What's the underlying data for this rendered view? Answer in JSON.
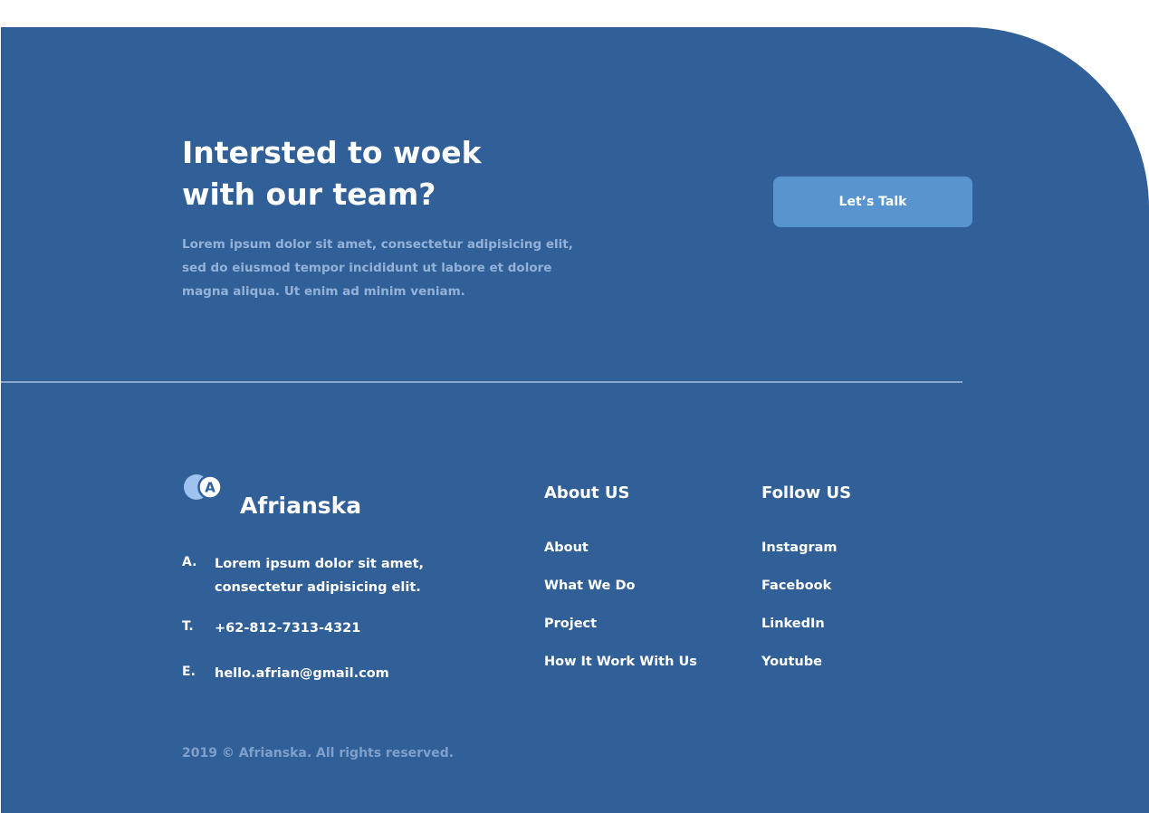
{
  "colors": {
    "page_background": "#ffffff",
    "footer_background": "#316098",
    "button_background": "#5894ce",
    "muted_text": "#94b2d9",
    "divider": "#8aa7cf",
    "logo_light_circle": "#9dc3ee"
  },
  "cta": {
    "heading_lines": [
      "Intersted to woek",
      "with our team?"
    ],
    "body_lines": [
      "Lorem ipsum dolor sit amet, consectetur adipisicing elit,",
      "sed do eiusmod tempor incididunt ut labore et dolore",
      "magna aliqua. Ut enim ad minim veniam."
    ],
    "button_label": "Let’s Talk"
  },
  "brand": {
    "logo_icon": "overlapping-circles-logo-icon",
    "logo_letter": "A",
    "name": "Afrianska"
  },
  "contact": {
    "address_key": "A.",
    "address_lines": [
      "Lorem ipsum dolor sit amet,",
      "consectetur adipisicing elit."
    ],
    "phone_key": "T.",
    "phone": "+62-812-7313-4321",
    "email_key": "E.",
    "email": "hello.afrian@gmail.com"
  },
  "about": {
    "title": "About US",
    "links": [
      "About",
      "What We Do",
      "Project",
      "How It Work With Us"
    ]
  },
  "follow": {
    "title": "Follow US",
    "links": [
      "Instagram",
      "Facebook",
      "LinkedIn",
      "Youtube"
    ]
  },
  "copyright": "2019 © Afrianska. All rights reserved."
}
